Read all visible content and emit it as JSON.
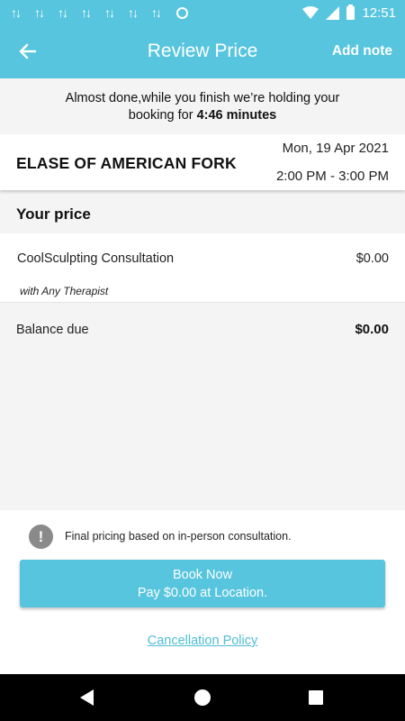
{
  "status_bar": {
    "time": "12:51",
    "icons": [
      "sync-icon",
      "sync-icon",
      "sync-icon",
      "sync-icon",
      "sync-icon",
      "sync-icon",
      "sync-icon",
      "circle-icon",
      "wifi-icon",
      "signal-icon",
      "battery-icon"
    ]
  },
  "app_bar": {
    "title": "Review Price",
    "add_note_label": "Add note",
    "back_icon": "arrow-left-icon"
  },
  "hold_banner": {
    "line1": "Almost done,while you finish we’re holding your",
    "line2_prefix": "booking for ",
    "countdown": "4:46 minutes"
  },
  "booking": {
    "venue": "ELASE OF AMERICAN FORK",
    "date": "Mon, 19 Apr 2021",
    "time": "2:00 PM - 3:00 PM"
  },
  "price": {
    "section_title": "Your price",
    "service_name": "CoolSculpting Consultation",
    "service_price": "$0.00",
    "therapist": "with Any Therapist",
    "balance_label": "Balance due",
    "balance_value": "$0.00"
  },
  "footer": {
    "info_icon": "exclamation-circle-icon",
    "note": "Final pricing based on in-person consultation.",
    "book_line1": "Book Now",
    "book_line2": "Pay $0.00 at Location.",
    "cancellation_label": "Cancellation Policy"
  },
  "colors": {
    "accent": "#56c5dd",
    "link": "#4fbdd6",
    "background": "#f4f4f4"
  }
}
